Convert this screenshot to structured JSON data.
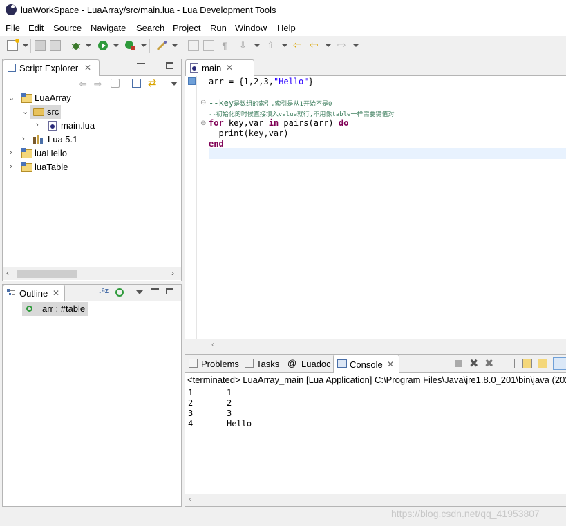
{
  "window": {
    "title": "luaWorkSpace - LuaArray/src/main.lua - Lua Development Tools"
  },
  "menu": [
    "File",
    "Edit",
    "Source",
    "Navigate",
    "Search",
    "Project",
    "Run",
    "Window",
    "Help"
  ],
  "script_explorer": {
    "tab_label": "Script Explorer",
    "tree": [
      {
        "label": "LuaArray",
        "expanded": true
      },
      {
        "label": "src",
        "expanded": true
      },
      {
        "label": "main.lua"
      },
      {
        "label": "Lua 5.1"
      },
      {
        "label": "luaHello"
      },
      {
        "label": "luaTable"
      }
    ]
  },
  "outline": {
    "tab_label": "Outline",
    "items": [
      {
        "label": "arr : #table"
      }
    ]
  },
  "editor": {
    "tab_label": "main",
    "lines": {
      "l1_a": "arr = {",
      "l1_b": "1,2,3,",
      "l1_c": "\"Hello\"",
      "l1_d": "}",
      "l2_a": "--key",
      "l2_b": "是数组的索引,索引是从1开始不是0",
      "l3": "--初始化的时候直接填入value就行,不用像table一样需要键值对",
      "l4_kw1": "for",
      "l4_a": " key,var ",
      "l4_kw2": "in",
      "l4_b": " pairs(arr) ",
      "l4_kw3": "do",
      "l5": "  print(key,var)",
      "l6": "end"
    }
  },
  "bottom_tabs": {
    "problems": "Problems",
    "tasks": "Tasks",
    "luadoc": "Luadoc",
    "console": "Console"
  },
  "console": {
    "header": "<terminated> LuaArray_main [Lua Application] C:\\Program Files\\Java\\jre1.8.0_201\\bin\\java (202",
    "rows": [
      {
        "key": "1",
        "value": "1"
      },
      {
        "key": "2",
        "value": "2"
      },
      {
        "key": "3",
        "value": "3"
      },
      {
        "key": "4",
        "value": "Hello"
      }
    ]
  },
  "watermark": "https://blog.csdn.net/qq_41953807",
  "colors": {
    "keyword": "#7f0055",
    "string": "#2a00ff",
    "comment": "#3f7f5f",
    "selection": "#d9e6f5",
    "current_line": "#e8f2fe"
  }
}
